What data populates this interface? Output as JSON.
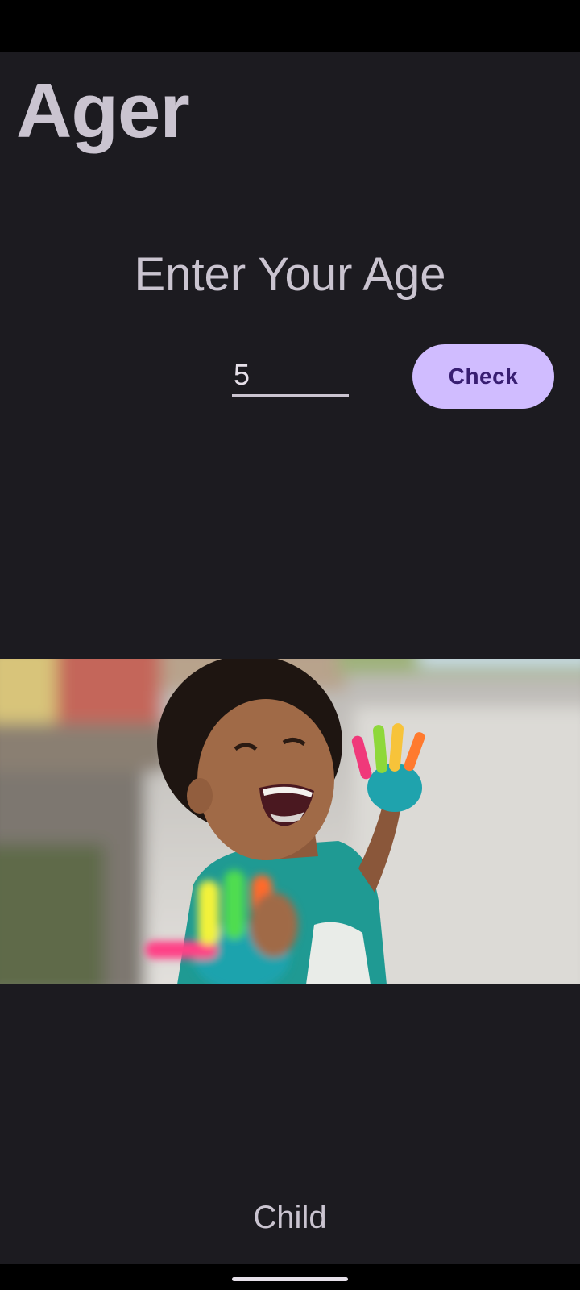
{
  "app": {
    "title": "Ager"
  },
  "prompt": {
    "label": "Enter Your Age"
  },
  "age_input": {
    "value": "5"
  },
  "check_button": {
    "label": "Check"
  },
  "photo": {
    "subject": "laughing child with painted hands"
  },
  "result": {
    "label": "Child"
  },
  "colors": {
    "background": "#1c1b20",
    "text": "#cac4d0",
    "button_bg": "#d0bcff",
    "button_text": "#381e72"
  }
}
